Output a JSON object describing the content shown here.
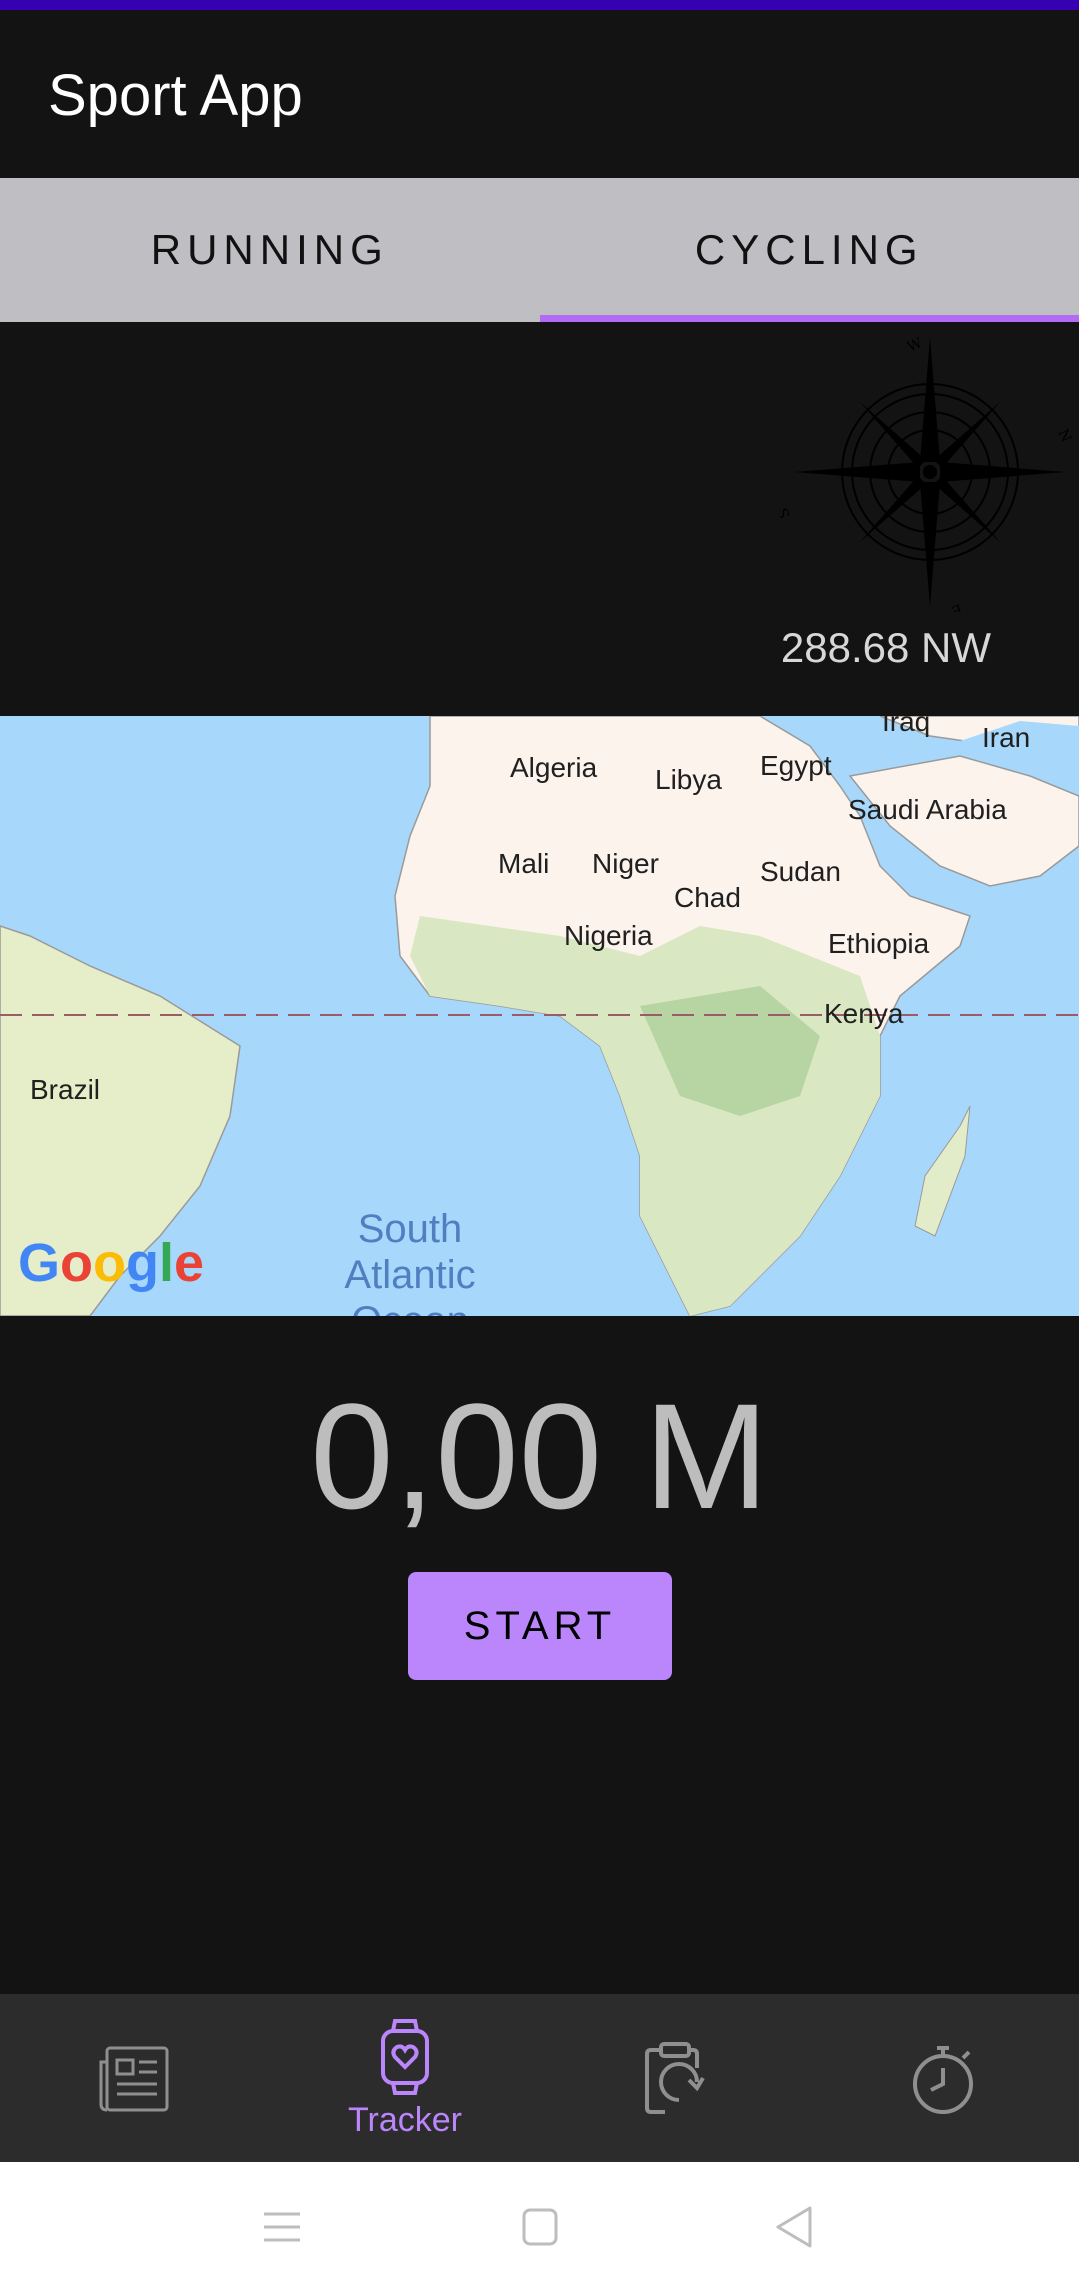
{
  "app": {
    "title": "Sport App"
  },
  "tabs": [
    {
      "label": "RUNNING",
      "selected": false
    },
    {
      "label": "CYCLING",
      "selected": true
    }
  ],
  "compass": {
    "heading_text": "288.68 NW",
    "icon": "compass-rose-icon"
  },
  "map": {
    "labels": [
      "Algeria",
      "Libya",
      "Egypt",
      "Iraq",
      "Iran",
      "Saudi Arabia",
      "Mali",
      "Niger",
      "Sudan",
      "Chad",
      "Nigeria",
      "Ethiopia",
      "Kenya",
      "Brazil"
    ],
    "ocean_label_line1": "South",
    "ocean_label_line2": "Atlantic",
    "ocean_label_line3": "Ocean",
    "attribution": "Google"
  },
  "tracker": {
    "distance": "0,00 M",
    "start_label": "START"
  },
  "bottom_nav": {
    "items": [
      {
        "icon": "newspaper-icon",
        "label": ""
      },
      {
        "icon": "smartwatch-heart-icon",
        "label": "Tracker",
        "selected": true
      },
      {
        "icon": "clipboard-history-icon",
        "label": ""
      },
      {
        "icon": "stopwatch-icon",
        "label": ""
      }
    ]
  },
  "colors": {
    "accent": "#bb86fc",
    "status_bar": "#3700b3",
    "background": "#131313",
    "tab_bar": "#bfbfc3",
    "nav_bar": "#2c2c2c"
  }
}
